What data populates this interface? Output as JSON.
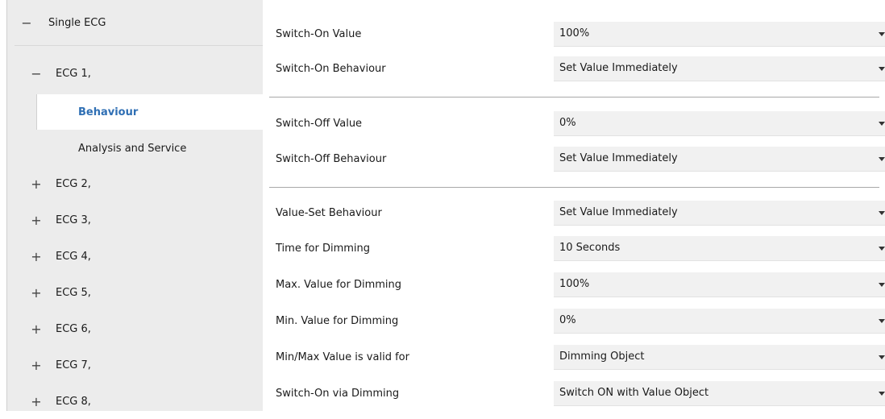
{
  "sidebar": {
    "root": {
      "sign": "−",
      "label": "Single ECG"
    },
    "ecg1": {
      "sign": "−",
      "label": "ECG 1,"
    },
    "behaviour": {
      "label": "Behaviour"
    },
    "analysis": {
      "label": "Analysis and Service"
    },
    "items": [
      {
        "sign": "+",
        "label": "ECG 2,"
      },
      {
        "sign": "+",
        "label": "ECG 3,"
      },
      {
        "sign": "+",
        "label": "ECG 4,"
      },
      {
        "sign": "+",
        "label": "ECG 5,"
      },
      {
        "sign": "+",
        "label": "ECG 6,"
      },
      {
        "sign": "+",
        "label": "ECG 7,"
      },
      {
        "sign": "+",
        "label": "ECG 8,"
      }
    ]
  },
  "params": [
    {
      "label": "Switch-On Value",
      "value": "100%"
    },
    {
      "label": "Switch-On Behaviour",
      "value": "Set Value Immediately"
    },
    {
      "label": "Switch-Off Value",
      "value": "0%"
    },
    {
      "label": "Switch-Off Behaviour",
      "value": "Set Value Immediately"
    },
    {
      "label": "Value-Set Behaviour",
      "value": "Set Value Immediately"
    },
    {
      "label": "Time for Dimming",
      "value": "10 Seconds"
    },
    {
      "label": "Max. Value for Dimming",
      "value": "100%"
    },
    {
      "label": "Min. Value for Dimming",
      "value": "0%"
    },
    {
      "label": "Min/Max Value is valid for",
      "value": "Dimming Object"
    },
    {
      "label": "Switch-On via Dimming",
      "value": "Switch ON with Value Object"
    }
  ],
  "colors": {
    "selected_text": "#2f6fb4",
    "sidebar_bg": "#ececec",
    "dropdown_bg": "#f1f1f1"
  }
}
